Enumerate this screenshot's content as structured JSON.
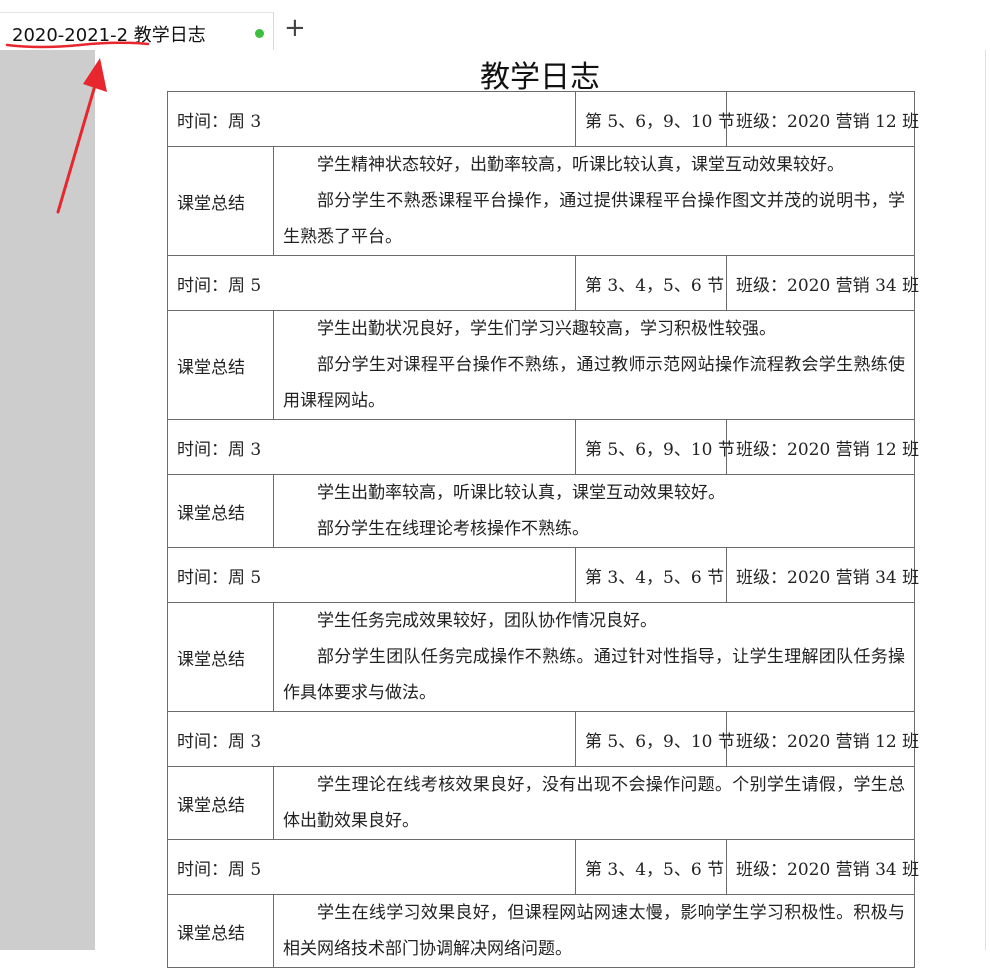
{
  "tabs": [
    {
      "label": "2020-2021-2  教学日志",
      "active": true,
      "unsaved_dot_color": "#3cbf3c"
    }
  ],
  "new_tab_icon": "plus-icon",
  "document": {
    "title": "教学日志",
    "entries": [
      {
        "time": "时间：周 3",
        "periods": "第 5、6，9、10 节",
        "class": "班级：2020 营销 12 班",
        "summary_label": "课堂总结",
        "summary": [
          "学生精神状态较好，出勤率较高，听课比较认真，课堂互动效果较好。",
          "部分学生不熟悉课程平台操作，通过提供课程平台操作图文并茂的说明书，学生熟悉了平台。"
        ]
      },
      {
        "time": "时间：周 5",
        "periods": "第 3、4，5、6 节",
        "class": "班级：2020 营销 34 班",
        "summary_label": "课堂总结",
        "summary": [
          "学生出勤状况良好，学生们学习兴趣较高，学习积极性较强。",
          "部分学生对课程平台操作不熟练，通过教师示范网站操作流程教会学生熟练使用课程网站。"
        ]
      },
      {
        "time": "时间：周 3",
        "periods": "第 5、6，9、10 节",
        "class": "班级：2020 营销 12 班",
        "summary_label": "课堂总结",
        "summary": [
          "学生出勤率较高，听课比较认真，课堂互动效果较好。",
          "部分学生在线理论考核操作不熟练。"
        ]
      },
      {
        "time": "时间：周 5",
        "periods": "第 3、4，5、6 节",
        "class": "班级：2020 营销 34 班",
        "summary_label": "课堂总结",
        "summary": [
          "学生任务完成效果较好，团队协作情况良好。",
          "部分学生团队任务完成操作不熟练。通过针对性指导，让学生理解团队任务操作具体要求与做法。"
        ]
      },
      {
        "time": "时间：周 3",
        "periods": "第 5、6，9、10 节",
        "class": "班级：2020 营销 12 班",
        "summary_label": "课堂总结",
        "summary": [
          "学生理论在线考核效果良好，没有出现不会操作问题。个别学生请假，学生总体出勤效果良好。"
        ]
      },
      {
        "time": "时间：周 5",
        "periods": "第 3、4，5、6 节",
        "class": "班级：2020 营销 34 班",
        "summary_label": "课堂总结",
        "summary": [
          "学生在线学习效果良好，但课程网站网速太慢，影响学生学习积极性。积极与相关网络技术部门协调解决网络问题。"
        ]
      }
    ]
  },
  "annotation_color": "#e8262d"
}
